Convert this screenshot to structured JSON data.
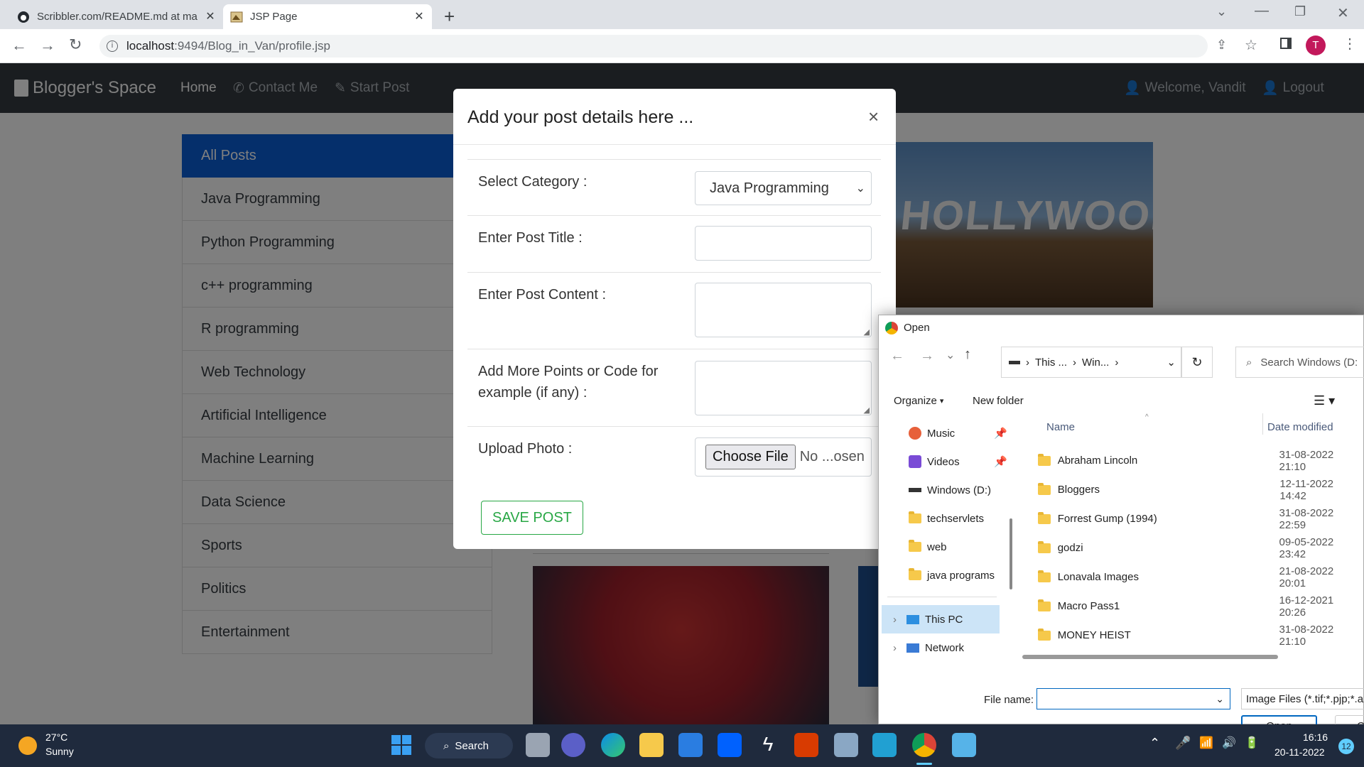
{
  "browser": {
    "tabs": [
      {
        "title": "Scribbler.com/README.md at ma",
        "active": false
      },
      {
        "title": "JSP Page",
        "active": true
      }
    ],
    "url_host": "localhost",
    "url_path": ":9494/Blog_in_Van/profile.jsp",
    "profile_initial": "T"
  },
  "navbar": {
    "brand": "Blogger's Space",
    "home": "Home",
    "contact": "Contact Me",
    "start_post": "Start Post",
    "welcome": "Welcome, Vandit",
    "logout": "Logout"
  },
  "sidebar": {
    "items": [
      "All Posts",
      "Java Programming",
      "Python Programming",
      "c++ programming",
      "R programming",
      "Web Technology",
      "Artificial Intelligence",
      "Machine Learning",
      "Data Science",
      "Sports",
      "Politics",
      "Entertainment"
    ]
  },
  "hero_text": "HOLLYWOOD",
  "modal": {
    "title": "Add your post details here ...",
    "close": "×",
    "category_label": "Select Category :",
    "category_value": "Java Programming",
    "title_label": "Enter Post Title :",
    "content_label": "Enter Post Content :",
    "points_label": "Add More Points or Code for example (if any) :",
    "upload_label": "Upload Photo :",
    "choose_file": "Choose File",
    "no_file": "No ...osen",
    "save": "SAVE POST"
  },
  "file_dialog": {
    "title": "Open",
    "breadcrumb": [
      "This ...",
      "Win..."
    ],
    "search_placeholder": "Search Windows (D:",
    "organize": "Organize",
    "new_folder": "New folder",
    "tree": [
      "Music",
      "Videos",
      "Windows (D:)",
      "techservlets",
      "web",
      "java programs",
      "This PC",
      "Network"
    ],
    "columns": {
      "name": "Name",
      "date": "Date modified"
    },
    "files": [
      {
        "name": "Abraham Lincoln",
        "date": "31-08-2022 21:10"
      },
      {
        "name": "Bloggers",
        "date": "12-11-2022 14:42"
      },
      {
        "name": "Forrest Gump (1994)",
        "date": "31-08-2022 22:59"
      },
      {
        "name": "godzi",
        "date": "09-05-2022 23:42"
      },
      {
        "name": "Lonavala Images",
        "date": "21-08-2022 20:01"
      },
      {
        "name": "Macro Pass1",
        "date": "16-12-2021 20:26"
      },
      {
        "name": "MONEY HEIST",
        "date": "31-08-2022 21:10"
      }
    ],
    "file_name_label": "File name:",
    "file_type": "Image Files (*.tif;*.pjp;*.ap",
    "open": "Open",
    "cancel": "Ca"
  },
  "taskbar": {
    "temp": "27°C",
    "weather": "Sunny",
    "search": "Search",
    "time": "16:16",
    "date": "20-11-2022",
    "notif_count": "12"
  },
  "colors": {
    "navbar": "#343a40",
    "accent": "#0b5ed7",
    "save": "#28a745"
  }
}
